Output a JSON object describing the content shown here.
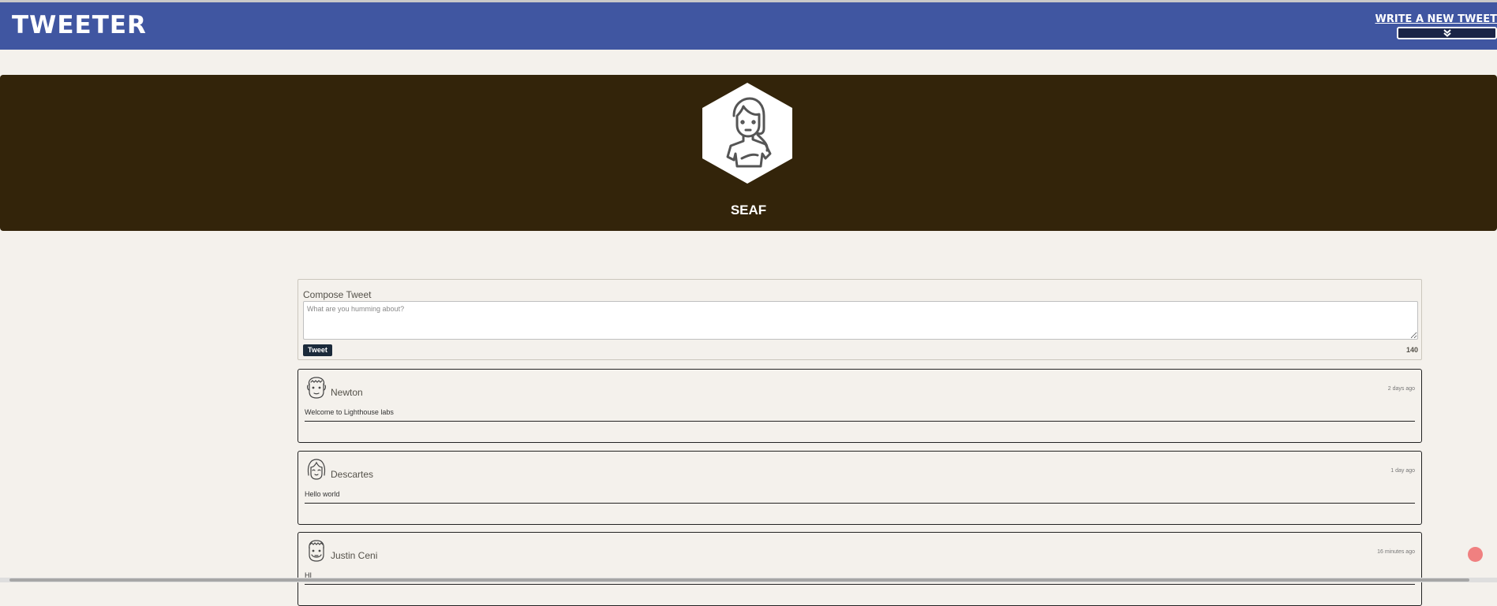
{
  "nav": {
    "brand": "TWEETER",
    "write_label": "WRITE A NEW TWEET",
    "toggle_icon": "double-chevron-down-icon"
  },
  "profile": {
    "avatar_icon": "user-avatar-icon",
    "username": "SEAF"
  },
  "compose": {
    "title": "Compose Tweet",
    "placeholder": "What are you humming about?",
    "value": "",
    "button_label": "Tweet",
    "counter": "140"
  },
  "tweets": [
    {
      "name": "Newton",
      "time": "2 days ago",
      "content": "Welcome to Lighthouse labs",
      "avatar_icon": "newton-avatar-icon"
    },
    {
      "name": "Descartes",
      "time": "1 day ago",
      "content": "Hello world",
      "avatar_icon": "descartes-avatar-icon"
    },
    {
      "name": "Justin Ceni",
      "time": "16 minutes ago",
      "content": "HI",
      "avatar_icon": "justin-avatar-icon"
    }
  ],
  "colors": {
    "nav_bg": "#4056a1",
    "header_bg": "#33240a",
    "page_bg": "#f4f1ec",
    "button_bg": "#1b2a3a"
  }
}
